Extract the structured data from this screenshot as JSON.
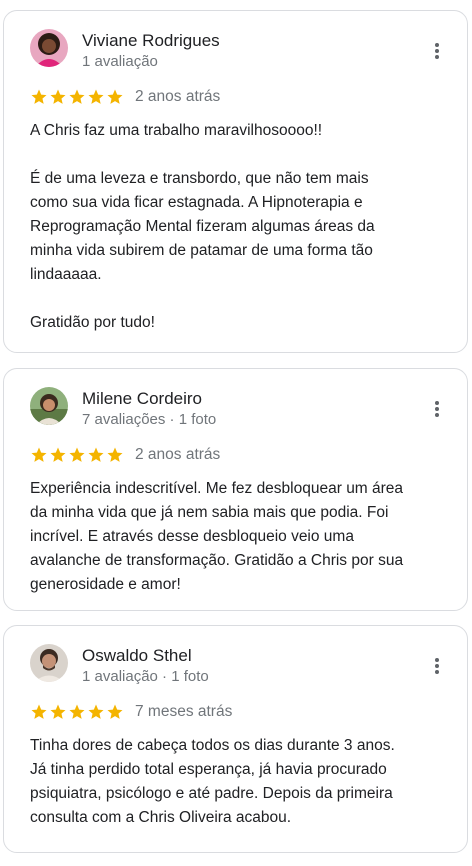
{
  "reviews": [
    {
      "name": "Viviane Rodrigues",
      "meta": "1 avaliação",
      "rating": 5,
      "date": "2 anos atrás",
      "text": "A Chris faz uma trabalho maravilhosoooo!!\n\nÉ de uma leveza e transbordo, que não tem  mais\ncomo sua vida ficar estagnada. A Hipnoterapia e\nReprogramação Mental fizeram algumas áreas da\nminha vida subirem de patamar de uma forma tão\nlindaaaaa.\n\nGratidão por tudo!"
    },
    {
      "name": "Milene Cordeiro",
      "meta": "7 avaliações · 1 foto",
      "rating": 5,
      "date": "2 anos atrás",
      "text": "Experiência indescritível. Me fez desbloquear um área\nda minha vida que já nem sabia mais que podia. Foi\nincrível. E através desse desbloqueio veio uma\navalanche de transformação. Gratidão a Chris por sua\ngenerosidade e amor!"
    },
    {
      "name": "Oswaldo Sthel",
      "meta": "1 avaliação · 1 foto",
      "rating": 5,
      "date": "7 meses atrás",
      "text": "Tinha dores de cabeça todos os dias durante 3 anos.\nJá tinha perdido total esperança, já havia procurado\npsiquiatra, psicólogo e até padre. Depois da primeira\nconsulta com a Chris Oliveira acabou."
    }
  ],
  "colors": {
    "star": "#f4b400",
    "meta": "#70757a",
    "border": "#dadce0"
  },
  "icons": {
    "star": "star-icon",
    "menu": "more-vert-icon"
  }
}
